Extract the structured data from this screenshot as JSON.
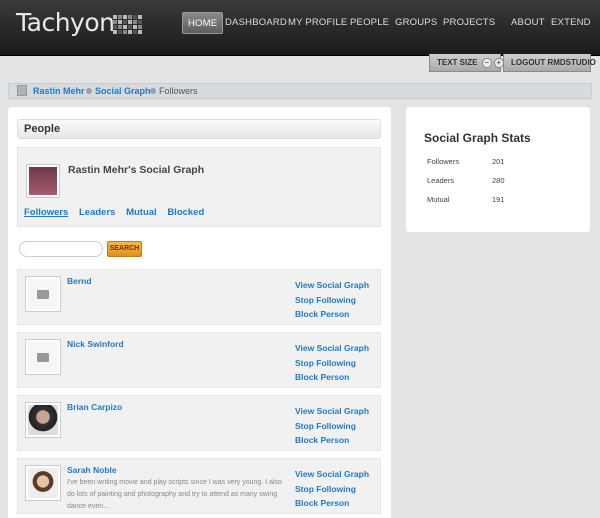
{
  "brand": {
    "name": "Tachyon"
  },
  "nav": {
    "items": [
      "HOME",
      "DASHBOARD",
      "MY PROFILE",
      "PEOPLE",
      "GROUPS",
      "PROJECTS",
      "ABOUT",
      "EXTEND"
    ],
    "active": "HOME"
  },
  "utility": {
    "text_size": "TEXT SIZE",
    "logout": "LOGOUT RMDSTUDIO"
  },
  "breadcrumb": {
    "items": [
      "Rastin Mehr",
      "Social Graph"
    ],
    "current": "Followers"
  },
  "people": {
    "heading": "People",
    "graph_title": "Rastin Mehr's Social Graph",
    "tabs": [
      "Followers",
      "Leaders",
      "Mutual",
      "Blocked"
    ],
    "selected_tab": "Followers",
    "search_button": "SEARCH",
    "list": [
      {
        "name": "Bernd",
        "bio": "",
        "avatar": "placeholder-camera-icon",
        "actions": [
          "View Social Graph",
          "Stop Following",
          "Block Person"
        ]
      },
      {
        "name": "Nick Swinford",
        "bio": "",
        "avatar": "placeholder-camera-icon",
        "actions": [
          "View Social Graph",
          "Stop Following",
          "Block Person"
        ]
      },
      {
        "name": "Brian Carpizo",
        "bio": "",
        "avatar": "photo",
        "actions": [
          "View Social Graph",
          "Stop Following",
          "Block Person"
        ]
      },
      {
        "name": "Sarah Noble",
        "bio": "I've been writing movie and play scripts since I was very young. I also do lots of painting and photography and try to attend as many swing dance even...",
        "avatar": "photo",
        "actions": [
          "View Social Graph",
          "Stop Following",
          "Block Person"
        ]
      }
    ]
  },
  "stats": {
    "title": "Social Graph Stats",
    "rows": [
      {
        "label": "Followers",
        "value": "201"
      },
      {
        "label": "Leaders",
        "value": "280"
      },
      {
        "label": "Mutual",
        "value": "191"
      }
    ]
  },
  "colors": {
    "link": "#1f7ac4",
    "search_button": "#f0a030",
    "header_bg": "#222222"
  }
}
